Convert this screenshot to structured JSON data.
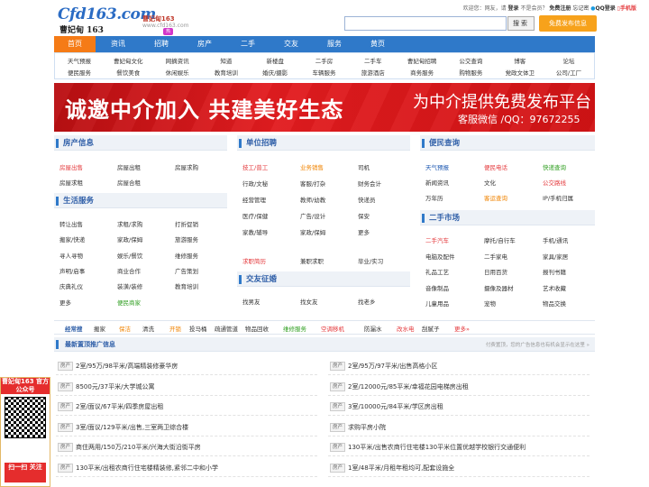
{
  "header": {
    "logo_main": "Cfd163.com",
    "logo_sub": "曹妃甸 163",
    "slogan": "曹妃甸163",
    "domain": "www.cfd163.com",
    "welcome": "欢迎您：网友，请",
    "login": "登录",
    "not_member": "不是会员？",
    "register": "免费注册",
    "forgot": "忘记密",
    "qq_login": "QQ登录",
    "mobile": "手机版",
    "search_placeholder": "",
    "search_btn": "搜索",
    "post_btn": "免费发布信息"
  },
  "nav": {
    "items": [
      "首页",
      "资讯",
      "招聘",
      "房产",
      "二手",
      "交友",
      "服务",
      "黄页"
    ],
    "active_index": 0,
    "hot_badge": "热"
  },
  "subnav": {
    "row1": [
      "天气预报",
      "曹妃甸文化",
      "网摘资讯",
      "知道",
      "新楼盘",
      "二手房",
      "二手车",
      "曹妃甸招聘",
      "公交查询",
      "博客",
      "论坛"
    ],
    "row2": [
      "便民服务",
      "餐饮美食",
      "休闲娱乐",
      "教育培训",
      "婚庆/摄影",
      "车辆服务",
      "旅游酒店",
      "商务服务",
      "购物服务",
      "党政文体卫",
      "公司/工厂"
    ]
  },
  "banner": {
    "left": "诚邀中介加入 共建美好生态",
    "right_main": "为中介提供免费发布平台",
    "right_sub": "客服微信 /QQ：97672255"
  },
  "house": {
    "title": "房产信息",
    "items": [
      [
        "房屋出售",
        "房屋出租",
        "房屋求购"
      ],
      [
        "房屋求租",
        "房屋合租",
        ""
      ]
    ]
  },
  "life": {
    "title": "生活服务",
    "items": [
      [
        "转让出售",
        "求租/求购",
        "打折促销"
      ],
      [
        "搬家/快递",
        "家政/保姆",
        "旅游服务"
      ],
      [
        "寻人寻物",
        "娱乐/餐饮",
        "维修服务"
      ],
      [
        "声明/启事",
        "商业合作",
        "广告策划"
      ],
      [
        "庆典礼仪",
        "装潢/装修",
        "教育培训"
      ],
      [
        "更多",
        "便民商家",
        ""
      ]
    ]
  },
  "jobs": {
    "title": "单位招聘",
    "items": [
      [
        "技工/普工",
        "业务销售",
        "司机"
      ],
      [
        "行政/文秘",
        "客服/打杂",
        "财务会计"
      ],
      [
        "经营管理",
        "教师/幼教",
        "快递员"
      ],
      [
        "医疗/保健",
        "广告/设计",
        "保安"
      ],
      [
        "家教/辅导",
        "家政/保姆",
        "更多"
      ]
    ],
    "seek_items": [
      "求职简历",
      "兼职求职",
      "毕业/实习"
    ]
  },
  "dating": {
    "title": "交友征婚",
    "items": [
      "找男友",
      "找女友",
      "找老乡"
    ]
  },
  "query": {
    "title": "便民查询",
    "items": [
      [
        "天气预报",
        "便民电话",
        "快递查询"
      ],
      [
        "新闻资讯",
        "文化",
        "公交路线"
      ],
      [
        "万年历",
        "客运查询",
        "IP/手机归属"
      ]
    ]
  },
  "secondhand": {
    "title": "二手市场",
    "items": [
      [
        "二手汽车",
        "摩托/自行车",
        "手机/通讯"
      ],
      [
        "电脑及配件",
        "二手家电",
        "家具/家居"
      ],
      [
        "礼品工艺",
        "日用百货",
        "报刊书籍"
      ],
      [
        "音像制品",
        "摄像及器材",
        "艺术收藏"
      ],
      [
        "儿童用品",
        "宠物",
        "物品交换"
      ]
    ]
  },
  "tags": {
    "title": "经常搜",
    "items": [
      "搬家",
      "保洁",
      "清洗",
      "开锁",
      "投马桶",
      "疏通管道",
      "物品回收",
      "维修服务",
      "空调移机",
      "防漏水",
      "改水电",
      "刮腻子",
      "更多»"
    ]
  },
  "listing": {
    "title": "最新置顶推广信息",
    "note": "付费置顶，您的广告信息也有机会显示在这里 »",
    "tag": "房产",
    "left": [
      "2室/95万/98平米/高端精装修豪华房",
      "8500元/37平米/大学城公寓",
      "2室/面议/67平米/四季房屋出租",
      "3室/面议/129平米/出售,三室两卫综合楼",
      "商住两用/150万/210平米/兴海大街沿街平房",
      "130平米/出租农商行住宅楼精装修,紧邻二中和小学"
    ],
    "right": [
      "2室/95万/97平米/出售高格小区",
      "2室/12000元/85平米/幸福花园电梯房出租",
      "3室/10000元/84平米/学区房出租",
      "求购平房小院",
      "130平米/出售农商行住宅楼130平米位置优越学校银行交通便利",
      "1室/48平米/月租年租均可,配套设施全"
    ]
  },
  "float": {
    "top": "曹妃甸163 官方公众号",
    "bottom": "扫一扫 关注"
  },
  "colors": {
    "primary": "#2f79c9",
    "accent": "#f57b16",
    "banner": "#d11315"
  }
}
